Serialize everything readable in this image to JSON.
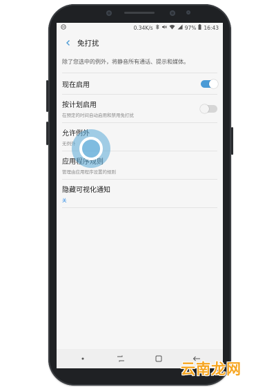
{
  "status_bar": {
    "left_icon": "do-not-disturb-icon",
    "speed": "0.34K/s",
    "battery": "97%",
    "time": "16:43",
    "icons": [
      "bluetooth-icon",
      "mute-icon",
      "wifi-icon",
      "signal-icon",
      "battery-icon"
    ]
  },
  "header": {
    "title": "免打扰",
    "back_icon": "back-arrow-icon"
  },
  "description": "除了您选中的例外，将静音所有通话、提示和媒体。",
  "settings": {
    "enable_now": {
      "label": "现在启用",
      "toggle": "on"
    },
    "scheduled": {
      "label": "按计划启用",
      "sub": "在预定的时间自动启用和禁用免打扰",
      "toggle": "off"
    },
    "exceptions": {
      "label": "允许例外",
      "sub": "无例外"
    },
    "app_rules": {
      "label": "应用程序规则",
      "sub": "管理由应用程序设置的规则"
    },
    "hide_notifications": {
      "label": "隐藏可视化通知",
      "sub": "关"
    }
  },
  "nav_bar": {
    "icons": [
      "dot-icon",
      "recent-apps-icon",
      "home-icon",
      "back-icon"
    ]
  },
  "watermark": "云南龙网",
  "colors": {
    "accent": "#4b9bd6",
    "link_blue": "#2a8ae6",
    "watermark": "#f6a623"
  }
}
